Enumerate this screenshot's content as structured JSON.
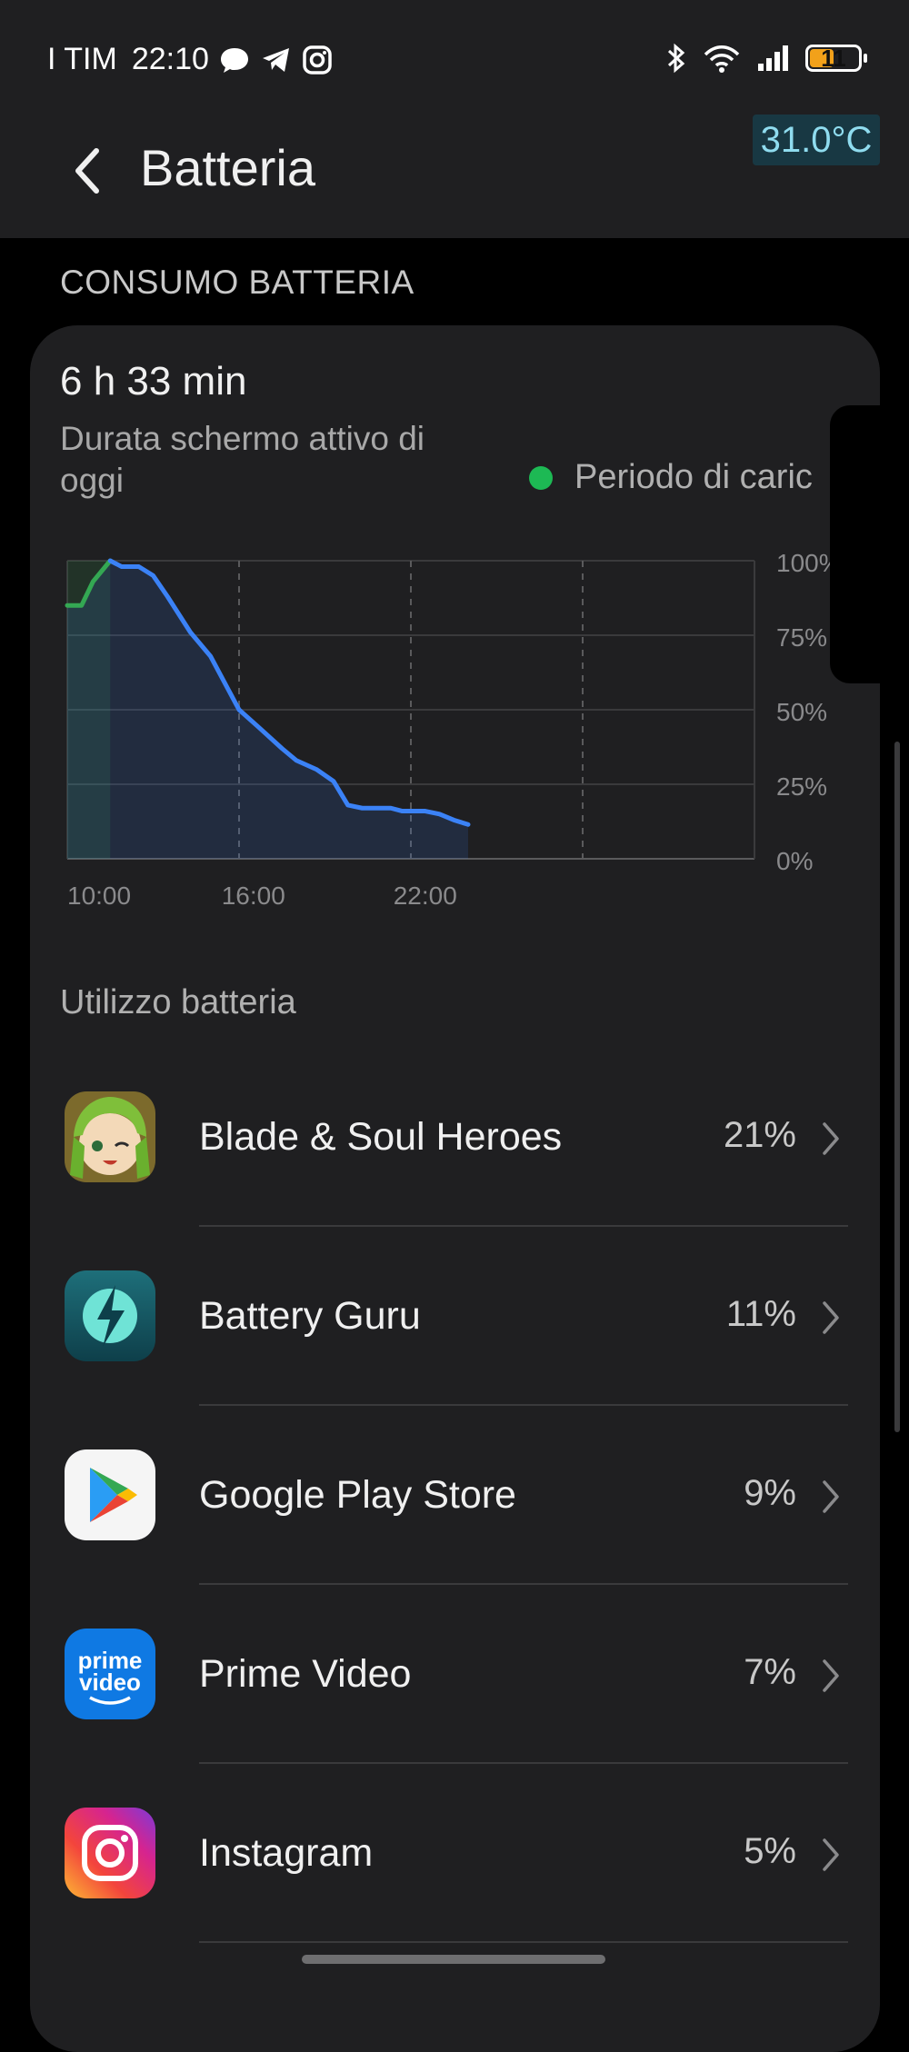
{
  "status_bar": {
    "carrier": "I TIM",
    "time": "22:10",
    "battery_level": "11",
    "icons": [
      "chat-icon",
      "telegram-icon",
      "instagram-icon",
      "bluetooth-icon",
      "wifi-icon",
      "signal-icon",
      "battery-icon"
    ]
  },
  "temperature": "31.0°C",
  "header": {
    "title": "Batteria"
  },
  "section": {
    "label": "CONSUMO BATTERIA"
  },
  "summary": {
    "screen_time": "6 h 33 min",
    "screen_time_label": "Durata schermo attivo di oggi",
    "legend_label": "Periodo di caric",
    "legend_color": "#1db954"
  },
  "colors": {
    "line": "#3b82f6",
    "charge": "#34a853",
    "card": "#1f1f21",
    "temp_bg": "#183843"
  },
  "chart_data": {
    "type": "area",
    "y_ticks": [
      "100%",
      "75%",
      "50%",
      "25%",
      "0%"
    ],
    "x_ticks": [
      "10:00",
      "16:00",
      "22:00"
    ],
    "ylim": [
      0,
      100
    ],
    "xlim": [
      9.5,
      33.5
    ],
    "charging_period": [
      9.5,
      11.0
    ],
    "series": [
      {
        "points": [
          [
            9.5,
            85
          ],
          [
            10.0,
            85
          ],
          [
            10.4,
            93
          ],
          [
            11.0,
            100
          ],
          [
            11.4,
            98
          ],
          [
            12.0,
            98
          ],
          [
            12.5,
            95
          ],
          [
            13.0,
            88
          ],
          [
            13.8,
            76
          ],
          [
            14.5,
            68
          ],
          [
            15.5,
            50
          ],
          [
            16.2,
            44
          ],
          [
            17.0,
            37
          ],
          [
            17.5,
            33
          ],
          [
            18.2,
            30
          ],
          [
            18.8,
            26
          ],
          [
            19.3,
            18
          ],
          [
            19.8,
            17
          ],
          [
            20.8,
            17
          ],
          [
            21.2,
            16
          ],
          [
            22.0,
            16
          ],
          [
            22.5,
            15
          ],
          [
            23.0,
            13
          ],
          [
            23.5,
            11.5
          ]
        ]
      }
    ]
  },
  "usage": {
    "label": "Utilizzo batteria",
    "apps": [
      {
        "name": "Blade & Soul Heroes",
        "percent": "21%",
        "icon": "blade-soul-heroes-icon"
      },
      {
        "name": "Battery Guru",
        "percent": "11%",
        "icon": "battery-guru-icon"
      },
      {
        "name": "Google Play Store",
        "percent": "9%",
        "icon": "google-play-icon"
      },
      {
        "name": "Prime Video",
        "percent": "7%",
        "icon": "prime-video-icon"
      },
      {
        "name": "Instagram",
        "percent": "5%",
        "icon": "instagram-app-icon"
      }
    ],
    "prime_icon_text": [
      "prime",
      "video"
    ]
  }
}
